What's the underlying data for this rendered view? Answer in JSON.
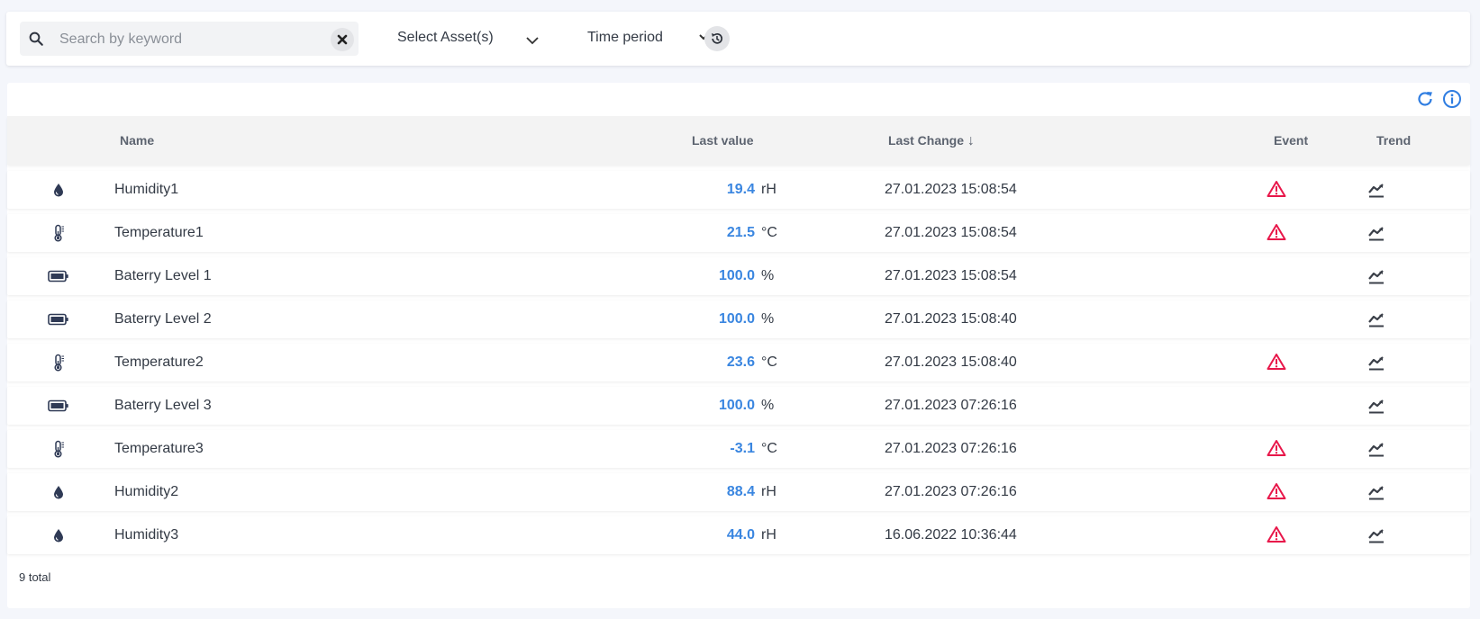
{
  "search": {
    "placeholder": "Search by keyword",
    "value": ""
  },
  "filters": {
    "asset_label": "Select Asset(s)",
    "time_label": "Time period"
  },
  "table": {
    "columns": {
      "name": "Name",
      "last_value": "Last value",
      "last_change": "Last Change",
      "sort_indicator": "↓",
      "event": "Event",
      "trend": "Trend"
    },
    "rows": [
      {
        "type": "humidity-icon",
        "name": "Humidity1",
        "value": "19.4",
        "unit": "rH",
        "time": "27.01.2023 15:08:54",
        "event": true
      },
      {
        "type": "thermometer-icon",
        "name": "Temperature1",
        "value": "21.5",
        "unit": "°C",
        "time": "27.01.2023 15:08:54",
        "event": true
      },
      {
        "type": "battery-icon",
        "name": "Baterry Level 1",
        "value": "100.0",
        "unit": "%",
        "time": "27.01.2023 15:08:54",
        "event": false
      },
      {
        "type": "battery-icon",
        "name": "Baterry Level 2",
        "value": "100.0",
        "unit": "%",
        "time": "27.01.2023 15:08:40",
        "event": false
      },
      {
        "type": "thermometer-icon",
        "name": "Temperature2",
        "value": "23.6",
        "unit": "°C",
        "time": "27.01.2023 15:08:40",
        "event": true
      },
      {
        "type": "battery-icon",
        "name": "Baterry Level 3",
        "value": "100.0",
        "unit": "%",
        "time": "27.01.2023 07:26:16",
        "event": false
      },
      {
        "type": "thermometer-icon",
        "name": "Temperature3",
        "value": "-3.1",
        "unit": "°C",
        "time": "27.01.2023 07:26:16",
        "event": true
      },
      {
        "type": "humidity-icon",
        "name": "Humidity2",
        "value": "88.4",
        "unit": "rH",
        "time": "27.01.2023 07:26:16",
        "event": true
      },
      {
        "type": "humidity-icon",
        "name": "Humidity3",
        "value": "44.0",
        "unit": "rH",
        "time": "16.06.2022 10:36:44",
        "event": true
      }
    ]
  },
  "footer": {
    "total": "9 total"
  },
  "colors": {
    "accent": "#3a86e0",
    "alert": "#e8174a",
    "icon_dark": "#2f3a55"
  }
}
